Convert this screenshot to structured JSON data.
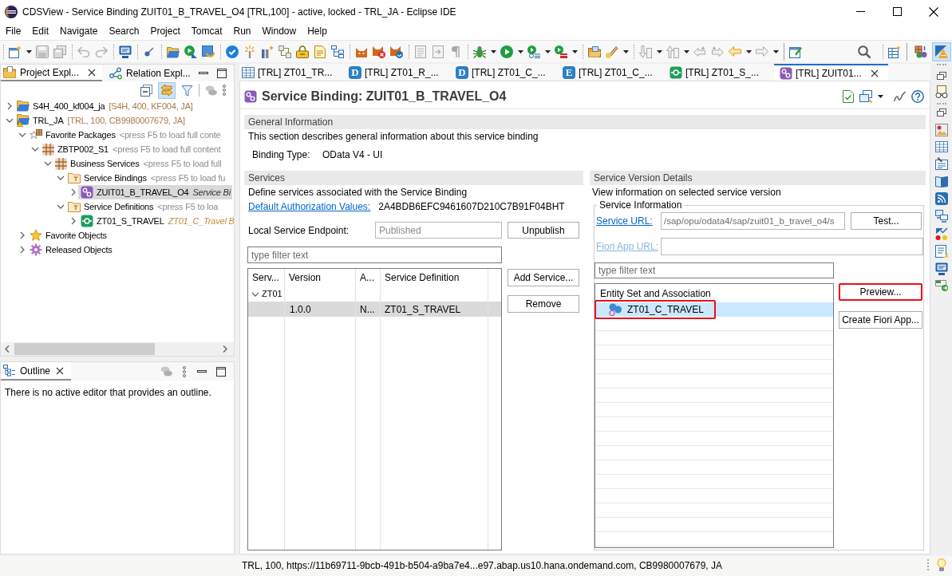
{
  "window": {
    "title": "CDSView - Service Binding ZUIT01_B_TRAVEL_O4 [TRL,100] - active, locked - TRL_JA - Eclipse IDE"
  },
  "menu_bar": [
    "File",
    "Edit",
    "Navigate",
    "Search",
    "Project",
    "Tomcat",
    "Run",
    "Window",
    "Help"
  ],
  "toolbar": {
    "perspectives": [
      {
        "kind": "package-bubbles",
        "selected": false
      },
      {
        "kind": "cone",
        "selected": true
      }
    ]
  },
  "explorer": {
    "tabs": [
      {
        "label": "Project Expl...",
        "kind": "project",
        "selected": true
      },
      {
        "label": "Relation Expl...",
        "kind": "relation",
        "selected": false
      }
    ],
    "link_with_editor": true,
    "tree": [
      {
        "label": "S4H_400_kf004_ja",
        "detail": "[S4H, 400, KF004, JA]",
        "kind": "system",
        "expanded": false,
        "selected": false
      },
      {
        "label": "TRL_JA",
        "detail": "[TRL, 100, CB9980007679, JA]",
        "kind": "system-warning",
        "expanded": true,
        "selected": false,
        "children": [
          {
            "label": "Favorite Packages",
            "detail": "<press F5 to load full conte",
            "kind": "favorite-packages",
            "expanded": true,
            "selected": false,
            "children": [
              {
                "label": "ZBTP002_S1",
                "detail": "<press F5 to load full content",
                "kind": "package",
                "expanded": true,
                "selected": false,
                "children": [
                  {
                    "label": "Business Services",
                    "detail": "<press F5 to load full",
                    "kind": "package",
                    "expanded": true,
                    "selected": false,
                    "children": [
                      {
                        "label": "Service Bindings",
                        "detail": "<press F5 to load fu",
                        "kind": "folder",
                        "expanded": true,
                        "selected": false,
                        "children": [
                          {
                            "label": "ZUIT01_B_TRAVEL_O4",
                            "detail": "Service Bi",
                            "kind": "binding",
                            "expanded": false,
                            "selected": true
                          }
                        ]
                      },
                      {
                        "label": "Service Definitions",
                        "detail": "<press F5 to loa",
                        "kind": "folder",
                        "expanded": true,
                        "selected": false,
                        "children": [
                          {
                            "label": "ZT01_S_TRAVEL",
                            "detail": "ZT01_C_Travel B",
                            "kind": "definition",
                            "expanded": false,
                            "selected": false
                          }
                        ]
                      }
                    ]
                  }
                ]
              }
            ]
          },
          {
            "label": "Favorite Objects",
            "kind": "favorite-objects",
            "expanded": false,
            "selected": false
          },
          {
            "label": "Released Objects",
            "kind": "released-objects",
            "expanded": false,
            "selected": false
          }
        ]
      }
    ]
  },
  "outline": {
    "tab": {
      "label": "Outline",
      "selected": true
    },
    "message": "There is no active editor that provides an outline."
  },
  "editor_tabs": [
    {
      "label": "[TRL] ZT01_TR...",
      "kind": "table",
      "selected": false
    },
    {
      "label": "[TRL] ZT01_R_...",
      "kind": "letter",
      "badge": "D",
      "selected": false
    },
    {
      "label": "[TRL] ZT01_C_...",
      "kind": "letter",
      "badge": "D",
      "selected": false
    },
    {
      "label": "[TRL] ZT01_C_...",
      "kind": "letter",
      "badge": "E",
      "selected": false
    },
    {
      "label": "[TRL] ZT01_S_...",
      "kind": "definition",
      "selected": false
    },
    {
      "label": "[TRL] ZUIT01...",
      "kind": "binding",
      "selected": true
    }
  ],
  "editor": {
    "title": "Service Binding: ZUIT01_B_TRAVEL_O4",
    "general": {
      "heading": "General Information",
      "description": "This section describes general information about this service binding",
      "binding_type_label": "Binding Type:",
      "binding_type": "OData V4 - UI"
    },
    "services": {
      "heading": "Services",
      "description": "Define services associated with the Service Binding",
      "auth_link": "Default Authorization Values:",
      "auth_value": "2A4BDB6EFC9461607D210C7B91F04BHT",
      "endpoint": {
        "label": "Local Service Endpoint:",
        "value": "Published",
        "read_only": true
      },
      "unpublish_button": "Unpublish",
      "filter": {
        "placeholder": "type filter text"
      },
      "table": {
        "columns": [
          "Serv...",
          "Version",
          "A...",
          "Service Definition"
        ],
        "rows": [
          {
            "kind": "service",
            "label": "ZT01",
            "expanded": true,
            "selected": false,
            "children": [
              {
                "kind": "version",
                "version": "1.0.0",
                "column_3": "N...",
                "service_definition": "ZT01_S_TRAVEL",
                "selected": true
              }
            ]
          }
        ]
      },
      "add_button": "Add Service...",
      "remove_button": "Remove"
    },
    "version_details": {
      "heading": "Service Version Details",
      "description": "View information on selected service version",
      "group_title": "Service Information",
      "service_url": {
        "label": "Service URL:",
        "value": "/sap/opu/odata4/sap/zuit01_b_travel_o4/s",
        "read_only": true,
        "disabled": false
      },
      "test_button": "Test...",
      "fiori_app_url": {
        "label": "Fiori App URL:",
        "disabled": true
      },
      "filter": {
        "placeholder": "type filter text"
      },
      "tree": {
        "header": "Entity Set and Association",
        "items": [
          {
            "label": "ZT01_C_TRAVEL",
            "selected": true,
            "highlighted": true
          }
        ]
      },
      "buttons": [
        {
          "label": "Preview...",
          "highlighted": true
        },
        {
          "label": "Create Fiori App...",
          "highlighted": false
        }
      ]
    }
  },
  "status_bar": {
    "text": "TRL, 100, https://11b69711-9bcb-491b-b504-a9ba7e4...e97.abap.us10.hana.ondemand.com, CB9980007679, JA"
  }
}
